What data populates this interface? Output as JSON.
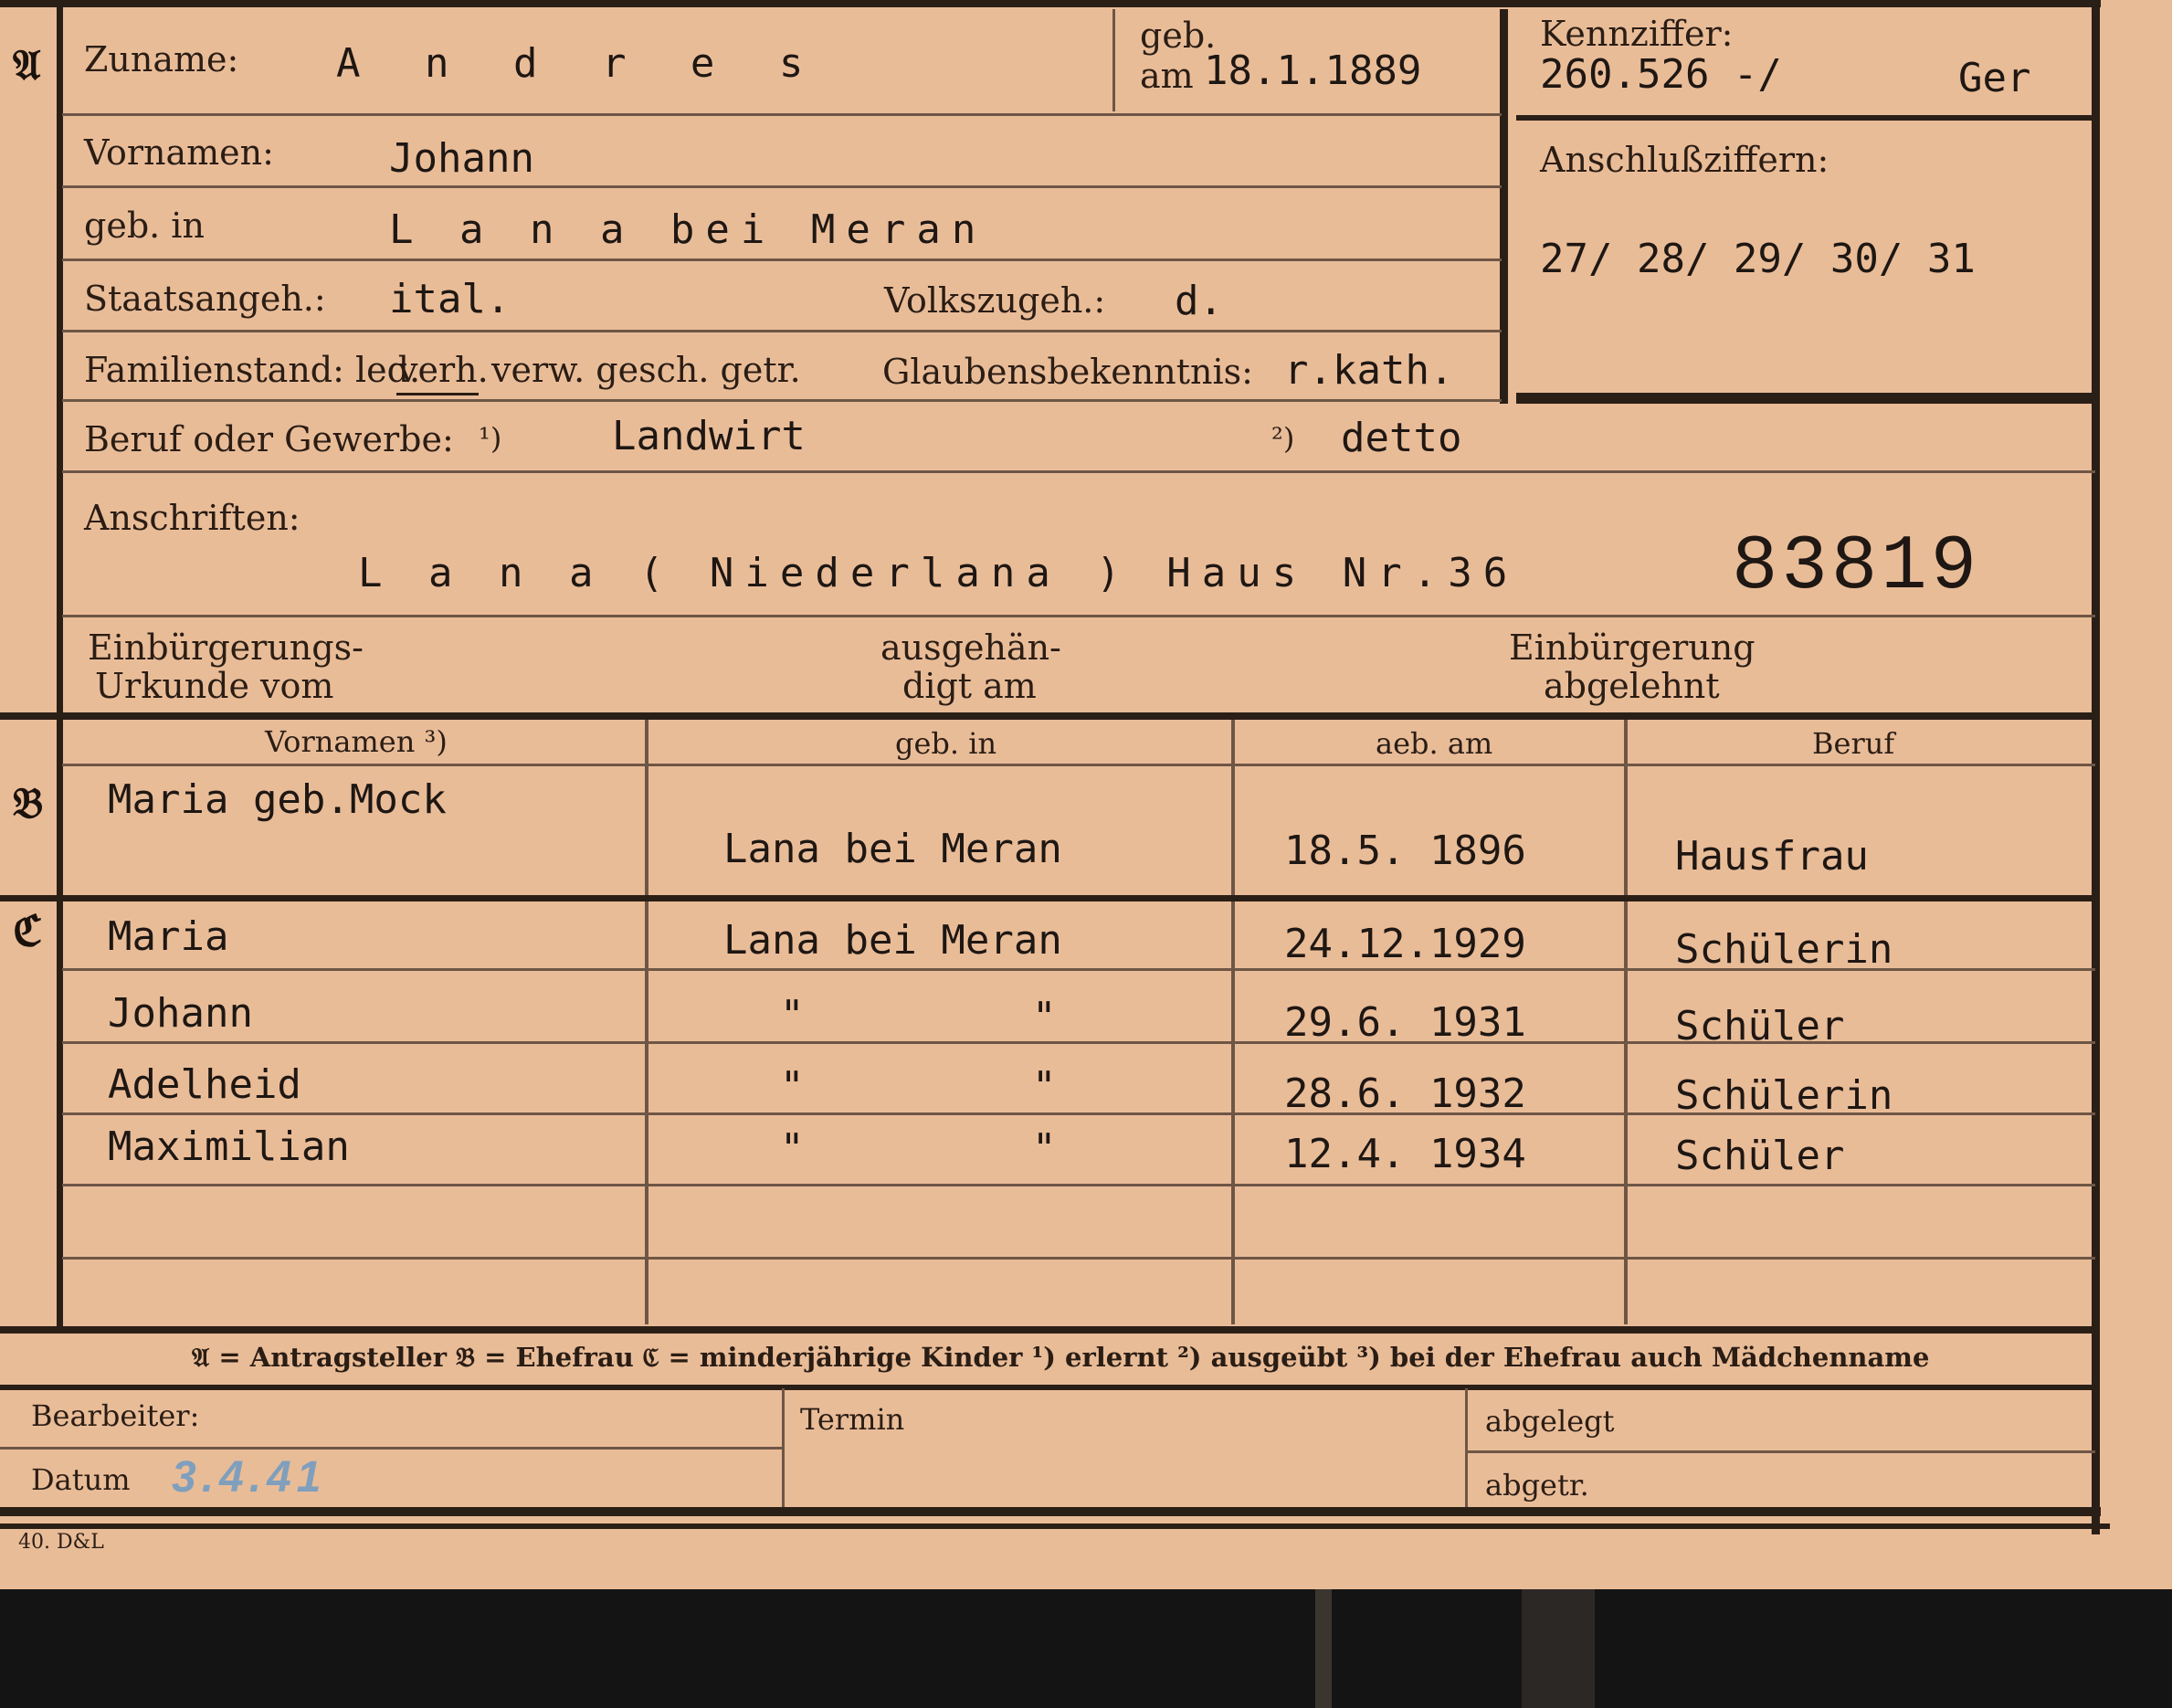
{
  "section_letters": {
    "a": "𝔄",
    "b": "𝔅",
    "c": "ℭ"
  },
  "applicant": {
    "zuname_label": "Zuname:",
    "zuname": "A n d r e s",
    "geb_am_label_1": "geb.",
    "geb_am_label_2": "am",
    "geb_am": "18.1.1889",
    "kennziffer_label": "Kennziffer:",
    "kennziffer": "260.526 -/",
    "kennziffer_suffix": "Ger",
    "anschluss_label": "Anschlußziffern:",
    "anschluss": "27/ 28/ 29/ 30/ 31",
    "vornamen_label": "Vornamen:",
    "vornamen": "Johann",
    "gebin_label": "geb. in",
    "gebin": "L a n a  bei Meran",
    "staats_label": "Staatsangeh.:",
    "staats": "ital.",
    "volks_label": "Volkszugeh.:",
    "volks": "d.",
    "familienstand_label": "Familienstand: led.",
    "familienstand_verh": "verh.",
    "familienstand_rest": "verw. gesch. getr.",
    "glauben_label": "Glaubensbekenntnis:",
    "glauben": "r.kath.",
    "beruf_label": "Beruf oder Gewerbe:",
    "beruf_mark1": "¹)",
    "beruf": "Landwirt",
    "beruf_mark2": "²)",
    "beruf2": "detto",
    "anschriften_label": "Anschriften:",
    "anschrift": "L a n a ( Niederlana ) Haus Nr.36",
    "stamp_number": "83819",
    "einb_label_1": "Einbürgerungs-",
    "einb_label_2": "Urkunde vom",
    "ausgeh_label_1": "ausgehän-",
    "ausgeh_label_2": "digt am",
    "abgelehnt_label_1": "Einbürgerung",
    "abgelehnt_label_2": "abgelehnt"
  },
  "table_headers": {
    "vornamen": "Vornamen ³)",
    "gebin": "geb. in",
    "gebam": "aeb. am",
    "beruf": "Beruf"
  },
  "spouse": {
    "vornamen": "Maria geb.Mock",
    "gebin": "Lana bei Meran",
    "gebam": "18.5. 1896",
    "beruf": "Hausfrau"
  },
  "children": [
    {
      "vornamen": "Maria",
      "gebin": "Lana bei Meran",
      "gebam": "24.12.1929",
      "beruf": "Schülerin"
    },
    {
      "vornamen": "Johann",
      "gebin_a": "\"",
      "gebin_b": "\"",
      "gebam": "29.6. 1931",
      "beruf": "Schüler"
    },
    {
      "vornamen": "Adelheid",
      "gebin_a": "\"",
      "gebin_b": "\"",
      "gebam": "28.6. 1932",
      "beruf": "Schülerin"
    },
    {
      "vornamen": "Maximilian",
      "gebin_a": "\"",
      "gebin_b": "\"",
      "gebam": "12.4. 1934",
      "beruf": "Schüler"
    }
  ],
  "legend": "𝔄 = Antragsteller   𝔅 = Ehefrau   ℭ = minderjährige Kinder   ¹) erlernt   ²) ausgeübt   ³) bei der Ehefrau auch Mädchenname",
  "footer": {
    "bearbeiter_label": "Bearbeiter:",
    "datum_label": "Datum",
    "datum": "3.4.41",
    "termin_label": "Termin",
    "abgelegt_label": "abgelegt",
    "abgetr_label": "abgetr.",
    "print_mark": "40. D&L"
  },
  "colors": {
    "paper": "#e9bc98",
    "ink": "#2a1d14",
    "date_ink": "#7f9fbd"
  }
}
